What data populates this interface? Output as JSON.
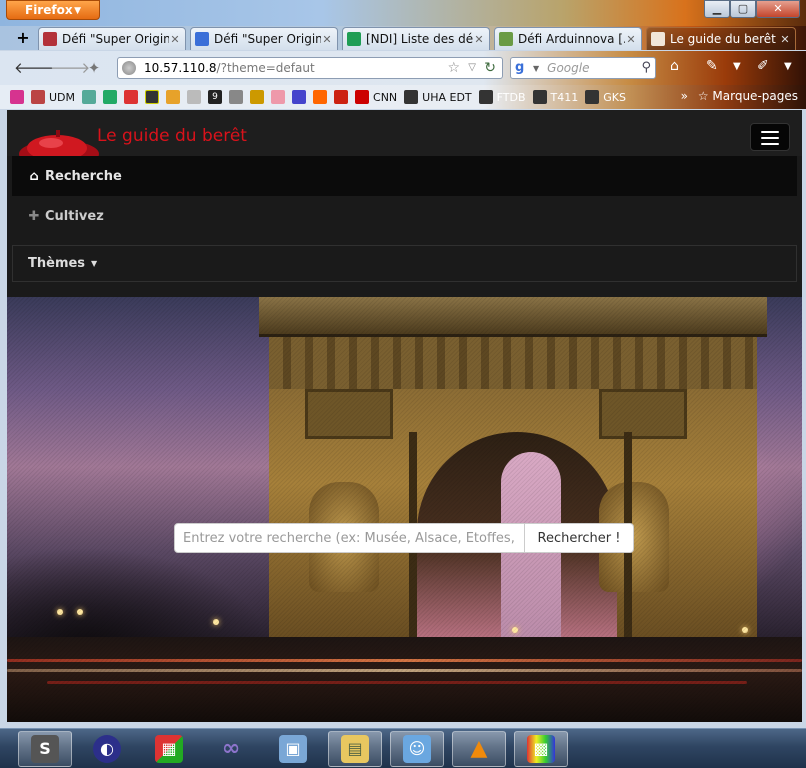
{
  "browser": {
    "app_button": "Firefox",
    "window_controls": {
      "minimize": "▁",
      "maximize": "▢",
      "close": "✕"
    },
    "tabs": [
      {
        "label": "Défi \"Super Origin...",
        "icon_color": "#b3323a",
        "icon": "tab-favicon-icon"
      },
      {
        "label": "Défi \"Super Origin...",
        "icon_color": "#3b6fd8",
        "icon": "google-docs-icon"
      },
      {
        "label": "[NDI] Liste des défis",
        "icon_color": "#1f9d55",
        "icon": "google-sheets-icon"
      },
      {
        "label": "Défi Arduinnova [...",
        "icon_color": "#6a9b45",
        "icon": "tab-favicon-icon"
      },
      {
        "label": "Le guide du berêt",
        "icon_color": "#f0e6d8",
        "icon": "page-icon",
        "active": true
      }
    ],
    "url": {
      "host": "10.57.110.8",
      "path": "/?theme=defaut"
    },
    "search": {
      "placeholder": "Google"
    },
    "bookmarks": [
      {
        "label": "",
        "color": "#d6338f"
      },
      {
        "label": "",
        "color": "#b44"
      },
      {
        "label": "UDM",
        "color": "#555"
      },
      {
        "label": "",
        "color": "#5a9"
      },
      {
        "label": "",
        "color": "#2a6"
      },
      {
        "label": "",
        "color": "#d33"
      },
      {
        "label": "",
        "color": "#333"
      },
      {
        "label": "",
        "color": "#e7a22a"
      },
      {
        "label": "",
        "color": "#bbb"
      },
      {
        "label": "9",
        "color": "#222"
      },
      {
        "label": "",
        "color": "#888"
      },
      {
        "label": "",
        "color": "#c90"
      },
      {
        "label": "",
        "color": "#e9a"
      },
      {
        "label": "",
        "color": "#44c"
      },
      {
        "label": "",
        "color": "#f60"
      },
      {
        "label": "",
        "color": "#c21"
      },
      {
        "label": "CNN",
        "color": "#c00"
      },
      {
        "label": "UHA EDT",
        "color": "#333"
      },
      {
        "label": "FTDB",
        "color": "#333"
      },
      {
        "label": "T411",
        "color": "#333"
      },
      {
        "label": "GKS",
        "color": "#333"
      }
    ],
    "bookmarks_more": "»",
    "bookmarks_menu": "Marque-pages"
  },
  "site": {
    "brand": "Le guide du berêt",
    "menu": {
      "home": "Recherche",
      "grow": "Cultivez",
      "themes": "Thèmes"
    },
    "search": {
      "placeholder": "Entrez votre recherche (ex: Musée, Alsace, Etoffes, ...)",
      "button": "Rechercher !"
    }
  },
  "taskbar": [
    {
      "name": "sublime-text",
      "color": "#555",
      "glyph": "S"
    },
    {
      "name": "eclipse",
      "color": "#2c2f8a",
      "glyph": "◐"
    },
    {
      "name": "windows-store",
      "color": "#d33",
      "glyph": "▦"
    },
    {
      "name": "visual-studio",
      "color": "#5b3a99",
      "glyph": "∞"
    },
    {
      "name": "virtualbox",
      "color": "#7aa7d6",
      "glyph": "▣"
    },
    {
      "name": "file-explorer",
      "color": "#e8c760",
      "glyph": "▤"
    },
    {
      "name": "finder",
      "color": "#6aa7e0",
      "glyph": "☺"
    },
    {
      "name": "vlc",
      "color": "#f08a0b",
      "glyph": "▲"
    },
    {
      "name": "media-player",
      "color": "#333",
      "glyph": "▩"
    }
  ]
}
